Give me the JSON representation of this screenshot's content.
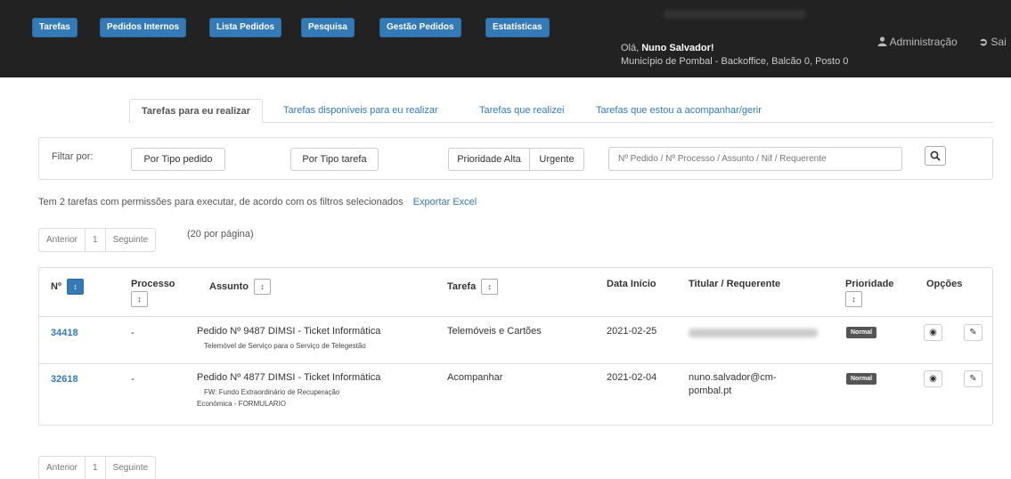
{
  "nav": {
    "buttons": [
      "Tarefas",
      "Pedidos Internos",
      "Lista Pedidos",
      "Pesquisa",
      "Gestão Pedidos",
      "Estatísticas"
    ],
    "greeting_prefix": "Olá, ",
    "user_name": "Nuno Salvador!",
    "location": "Município de Pombal - Backoffice, Balcão 0, Posto 0",
    "admin": "Administração",
    "logout": "Sai",
    "admin_icon": "user-icon",
    "logout_icon": "sign-out-icon"
  },
  "tabs": [
    {
      "label": "Tarefas para eu realizar",
      "active": true
    },
    {
      "label": "Tarefas disponíveis para eu realizar"
    },
    {
      "label": "Tarefas que realizei"
    },
    {
      "label": "Tarefas que estou a acompanhar/gerir"
    }
  ],
  "filters": {
    "label": "Filtar por:",
    "tipo_pedido": "Por Tipo pedido",
    "tipo_tarefa": "Por Tipo tarefa",
    "prioridade_alta": "Prioridade Alta",
    "urgente": "Urgente",
    "search_placeholder": "Nº Pedido / Nº Processo / Assunto / Nif / Requerente"
  },
  "summary": {
    "text": "Tem 2 tarefas com permissões para executar, de acordo com os filtros selecionados",
    "export": "Exportar Excel"
  },
  "pager": {
    "prev": "Anterior",
    "page": "1",
    "next": "Seguinte",
    "per_page": "(20 por página)"
  },
  "table": {
    "headers": {
      "num": "Nº",
      "processo": "Processo",
      "assunto": "Assunto",
      "tarefa": "Tarefa",
      "data_inicio": "Data Início",
      "titular": "Titular / Requerente",
      "prioridade": "Prioridade",
      "opcoes": "Opções"
    },
    "rows": [
      {
        "num": "34418",
        "processo": "-",
        "assunto": "Pedido Nº 9487 DIMSI - Ticket Informática",
        "assunto_sub": [
          "Telemóvel de Serviço para o Serviço de Telegestão"
        ],
        "tarefa": "Telemóveis e Cartões",
        "data": "2021-02-25",
        "titular": [
          "",
          ""
        ],
        "prioridade": "Normal"
      },
      {
        "num": "32618",
        "processo": "-",
        "assunto": "Pedido Nº 4877 DIMSI - Ticket Informática",
        "assunto_sub": [
          "FW: Fundo Extraordinário de Recuperação",
          "Económica - FORMULARIO"
        ],
        "tarefa": "Acompanhar",
        "data": "2021-02-04",
        "titular": [
          "nuno.salvador@cm-",
          "pombal.pt"
        ],
        "prioridade": "Normal"
      }
    ]
  }
}
